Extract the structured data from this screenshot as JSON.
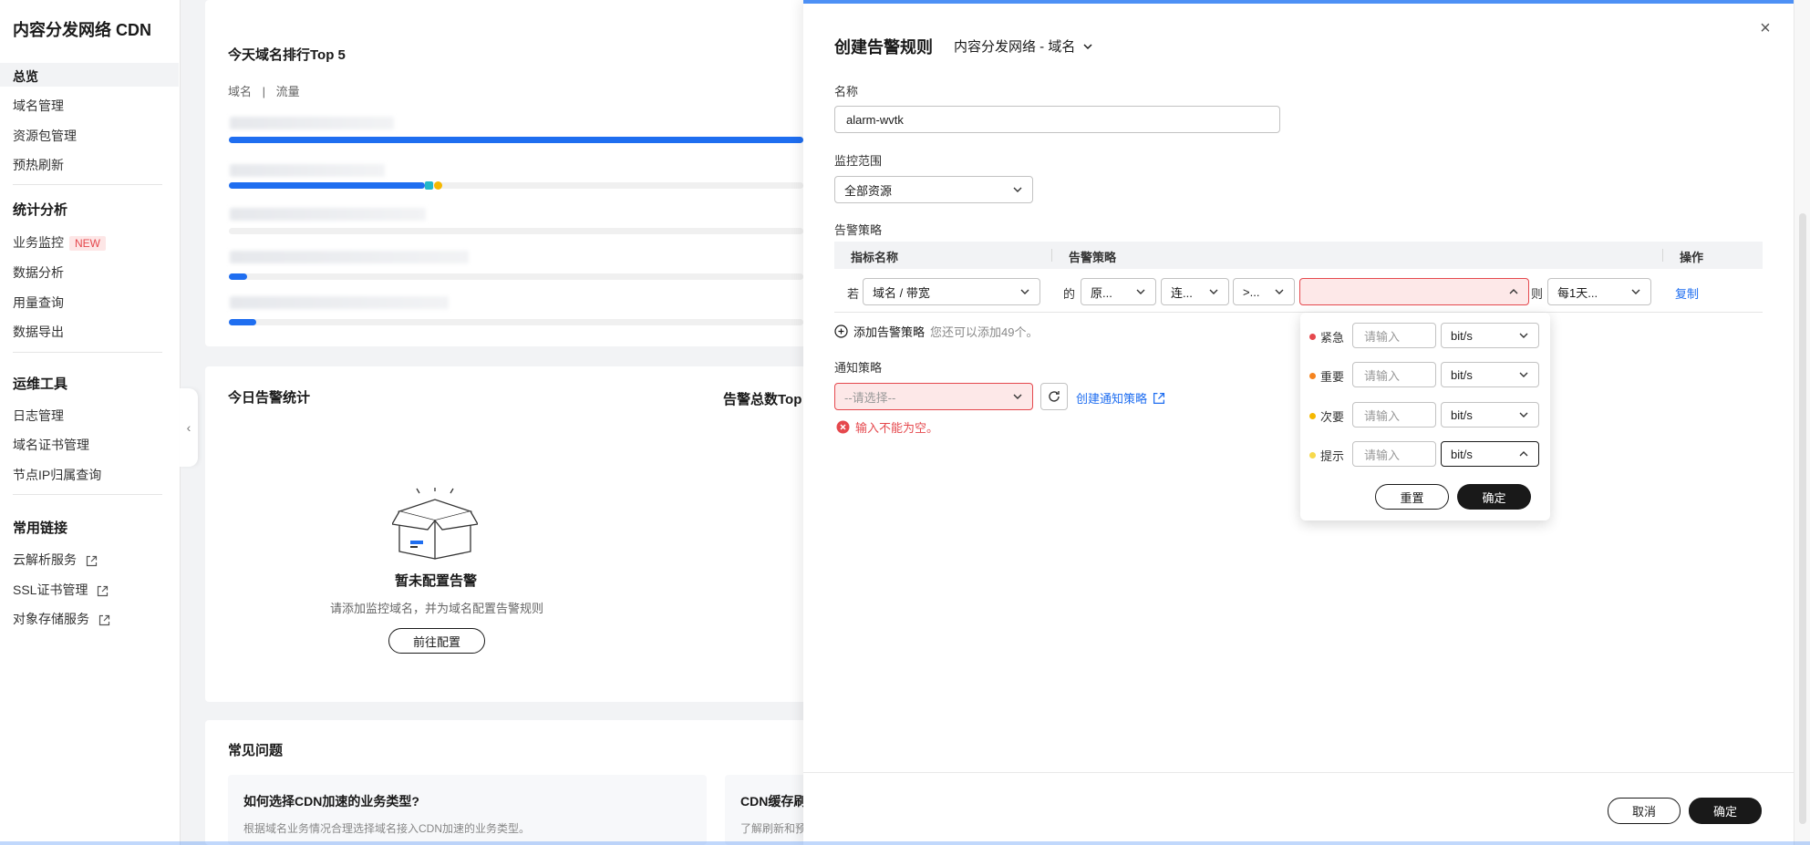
{
  "sidebar": {
    "title": "内容分发网络 CDN",
    "overview": "总览",
    "items_main": [
      "域名管理",
      "资源包管理",
      "预热刷新"
    ],
    "group_stats": "统计分析",
    "stats_items": [
      "业务监控",
      "数据分析",
      "用量查询",
      "数据导出"
    ],
    "new_badge": "NEW",
    "group_ops": "运维工具",
    "ops_items": [
      "日志管理",
      "域名证书管理",
      "节点IP归属查询"
    ],
    "group_links": "常用链接",
    "link_items": [
      "云解析服务",
      "SSL证书管理",
      "对象存储服务"
    ]
  },
  "main": {
    "top5_title": "今天域名排行Top 5",
    "top5_tab_domain": "域名",
    "top5_tab_sep": "|",
    "top5_tab_traffic": "流量",
    "alarm_title": "今日告警统计",
    "alarm_top_title": "告警总数Top",
    "empty_title": "暂未配置告警",
    "empty_desc": "请添加监控域名，并为域名配置告警规则",
    "empty_button": "前往配置",
    "faq_title": "常见问题",
    "faq1_title": "如何选择CDN加速的业务类型?",
    "faq1_desc": "根据域名业务情况合理选择域名接入CDN加速的业务类型。",
    "faq2_title": "CDN缓存刷",
    "faq2_desc": "了解刷新和预"
  },
  "drawer": {
    "title": "创建告警规则",
    "subtitle": "内容分发网络 - 域名",
    "name_label": "名称",
    "name_value": "alarm-wvtk",
    "scope_label": "监控范围",
    "scope_value": "全部资源",
    "policy_label": "告警策略",
    "col_metric": "指标名称",
    "col_policy": "告警策略",
    "col_action": "操作",
    "row_if": "若",
    "row_metric": "域名 / 带宽",
    "row_of": "的",
    "row_stat": "原...",
    "row_period": "连...",
    "row_op": ">...",
    "row_then": "则",
    "row_freq": "每1天...",
    "row_copy": "复制",
    "add_policy": "添加告警策略",
    "add_hint": "您还可以添加49个。",
    "notify_label": "通知策略",
    "notify_placeholder": "--请选择--",
    "create_notify": "创建通知策略",
    "error_msg": "输入不能为空。",
    "cancel": "取消",
    "confirm": "确定"
  },
  "popover": {
    "levels": [
      {
        "name": "紧急",
        "color": "#e5484d",
        "placeholder": "请输入",
        "unit": "bit/s"
      },
      {
        "name": "重要",
        "color": "#f5841f",
        "placeholder": "请输入",
        "unit": "bit/s"
      },
      {
        "name": "次要",
        "color": "#f5b800",
        "placeholder": "请输入",
        "unit": "bit/s"
      },
      {
        "name": "提示",
        "color": "#f7d94c",
        "placeholder": "请输入",
        "unit": "bit/s"
      }
    ],
    "reset": "重置",
    "confirm": "确定"
  },
  "colors": {
    "accent": "#1f6ef0",
    "error": "#e5484d",
    "primary_button": "#191919"
  }
}
